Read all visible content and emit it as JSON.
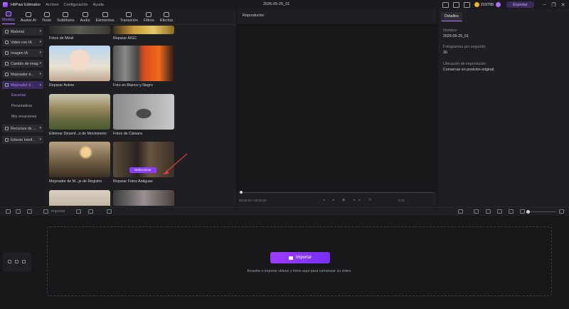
{
  "app": {
    "name": "HitPaw Edimakor",
    "menus": [
      "Archivo",
      "Configuración",
      "Ayuda"
    ],
    "project_title": "2026-05-25_01",
    "coins": "219795",
    "export_label": "Exportar"
  },
  "toolbar": {
    "tabs": [
      {
        "label": "Medios",
        "icon": "media-icon"
      },
      {
        "label": "Avatar AI",
        "icon": "avatar-icon"
      },
      {
        "label": "Texto",
        "icon": "text-icon"
      },
      {
        "label": "Subtítulos",
        "icon": "subtitles-icon"
      },
      {
        "label": "Audio",
        "icon": "audio-icon"
      },
      {
        "label": "Elementos",
        "icon": "elements-icon"
      },
      {
        "label": "Transición",
        "icon": "transition-icon"
      },
      {
        "label": "Filtros",
        "icon": "filters-icon"
      },
      {
        "label": "Efectos",
        "icon": "effects-icon"
      }
    ],
    "active_tab": "Medios"
  },
  "sidebar": {
    "items": [
      {
        "label": "Material"
      },
      {
        "label": "Video con IA"
      },
      {
        "label": "Imagen IA"
      },
      {
        "label": "Cambio de imag..."
      },
      {
        "label": "Mejorador d..."
      },
      {
        "label": "Mejorador d..."
      },
      {
        "label": "Recursos de ..."
      },
      {
        "label": "Edición IntelI..."
      }
    ],
    "subitems": [
      {
        "label": "Escenas",
        "active": true
      },
      {
        "label": "Personalizar",
        "active": false
      },
      {
        "label": "Mis creaciones",
        "active": false
      }
    ]
  },
  "grid": {
    "cards": [
      {
        "caption": "Fotos de Móvil"
      },
      {
        "caption": "Reparar AIGC"
      },
      {
        "caption": "Reparar Anime"
      },
      {
        "caption": "Foto en Blanco y Negro"
      },
      {
        "caption": "Eliminar Desenf...o de Movimiento"
      },
      {
        "caption": "Fotos de Cámara"
      },
      {
        "caption": "Mejorador de M...je de Registro"
      },
      {
        "caption": "Reparar Fotos Antiguas"
      }
    ],
    "select_label": "Seleccionar"
  },
  "player": {
    "title": "Reproductor",
    "time": "00:00:00 / 00:00:00",
    "zoom": "0:16"
  },
  "details": {
    "tab": "Detalles",
    "fields": [
      {
        "label": "Nombre:",
        "value": "2026-05-25_01"
      },
      {
        "label": "Fotogramas por segundo:",
        "value": "30"
      },
      {
        "label": "Ubicación de importación:",
        "value": "Conservar en posición original"
      }
    ]
  },
  "timeline": {
    "toolbar_import": "Importar",
    "zoom_level": 0.05,
    "import_button": "Importar",
    "drop_hint": "Arrastre o importe videos y fotos aquí para comenzar su video."
  },
  "colors": {
    "accent": "#b67cff",
    "button": "#8a3dff",
    "background": "#17171a",
    "panel": "#1f1f23"
  }
}
